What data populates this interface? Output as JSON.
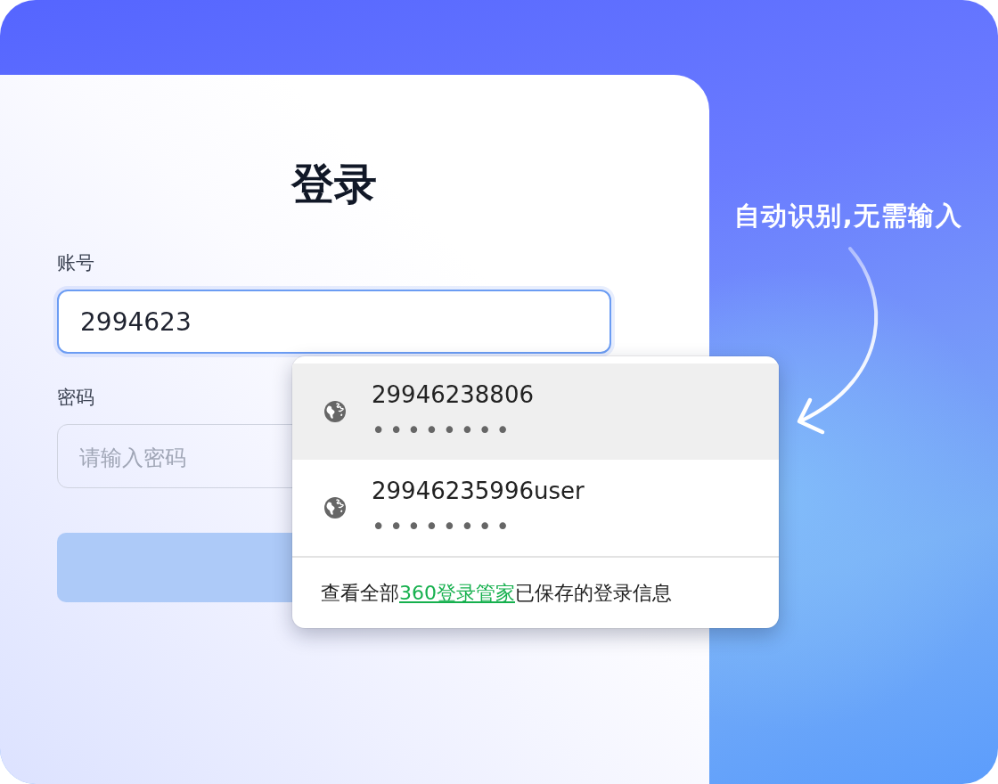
{
  "title": "登录",
  "fields": [
    {
      "label": "账号",
      "value": "2994623",
      "focused": true
    },
    {
      "label": "密码",
      "placeholder": "请输入密码",
      "focused": false
    }
  ],
  "suggestions": {
    "items": [
      {
        "username": "29946238806",
        "password_mask": "••••••••",
        "selected": true
      },
      {
        "username": "29946235996user",
        "password_mask": "••••••••",
        "selected": false
      }
    ],
    "footer": {
      "before": "查看全部",
      "link": "360登录管家",
      "after": "已保存的登录信息"
    }
  },
  "hint": {
    "text": "自动识别,无需输入"
  }
}
